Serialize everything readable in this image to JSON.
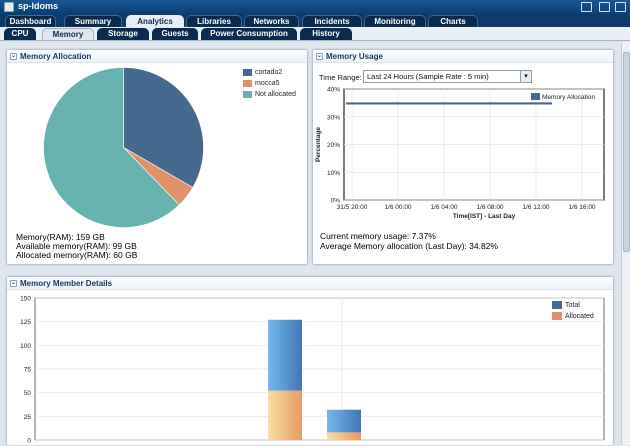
{
  "window": {
    "title": "sp-ldoms"
  },
  "main_tabs": [
    {
      "label": "Dashboard"
    },
    {
      "label": "Summary"
    },
    {
      "label": "Analytics"
    },
    {
      "label": "Libraries"
    },
    {
      "label": "Networks"
    },
    {
      "label": "Incidents"
    },
    {
      "label": "Monitoring"
    },
    {
      "label": "Charts"
    }
  ],
  "active_main_tab": "Analytics",
  "sub_tabs": [
    {
      "label": "CPU"
    },
    {
      "label": "Memory"
    },
    {
      "label": "Storage"
    },
    {
      "label": "Guests"
    },
    {
      "label": "Power Consumption"
    },
    {
      "label": "History"
    }
  ],
  "active_sub_tab": "Memory",
  "memory_allocation": {
    "header": "Memory Allocation",
    "memory_ram": "Memory(RAM): 159 GB",
    "available": "Available memory(RAM): 99 GB",
    "allocated": "Allocated memory(RAM): 60 GB",
    "chart_data": {
      "type": "pie",
      "labels": [
        "cortado2",
        "mocca5",
        "Not allocated"
      ],
      "values": [
        53,
        7,
        99
      ],
      "colors": [
        "#46698f",
        "#e0916a",
        "#66b2af"
      ]
    }
  },
  "memory_usage": {
    "header": "Memory Usage",
    "time_range_label": "Time Range:",
    "time_range_value": "Last 24 Hours (Sample Rate : 5 min)",
    "current_usage": "Current memory usage: 7.37%",
    "avg_allocation": "Average Memory allocation (Last Day): 34.82%",
    "chart_data": {
      "type": "line",
      "ylabel": "Percentage",
      "xlabel": "Time[IST] - Last Day",
      "y_ticks": [
        "0%",
        "10%",
        "20%",
        "30%",
        "40%"
      ],
      "x_ticks": [
        "31/5 20:00",
        "1/6 00:00",
        "1/6 04:00",
        "1/6 08:00",
        "1/6 12:00",
        "1/6 16:00"
      ],
      "ylim": [
        0,
        40
      ],
      "series": [
        {
          "name": "Memory Allocation",
          "values": [
            34.8,
            34.8
          ]
        }
      ],
      "color": "#46698f"
    }
  },
  "member_details": {
    "header": "Memory Member Details",
    "chart_data": {
      "type": "bar",
      "y_ticks": [
        "0",
        "25",
        "50",
        "75",
        "100",
        "125",
        "150"
      ],
      "ylim": [
        0,
        150
      ],
      "series": [
        {
          "name": "Total",
          "values": [
            127,
            32
          ]
        },
        {
          "name": "Allocated",
          "values": [
            52,
            8
          ]
        }
      ],
      "colors": [
        "#4f87c4",
        "#e4a46a"
      ]
    }
  }
}
